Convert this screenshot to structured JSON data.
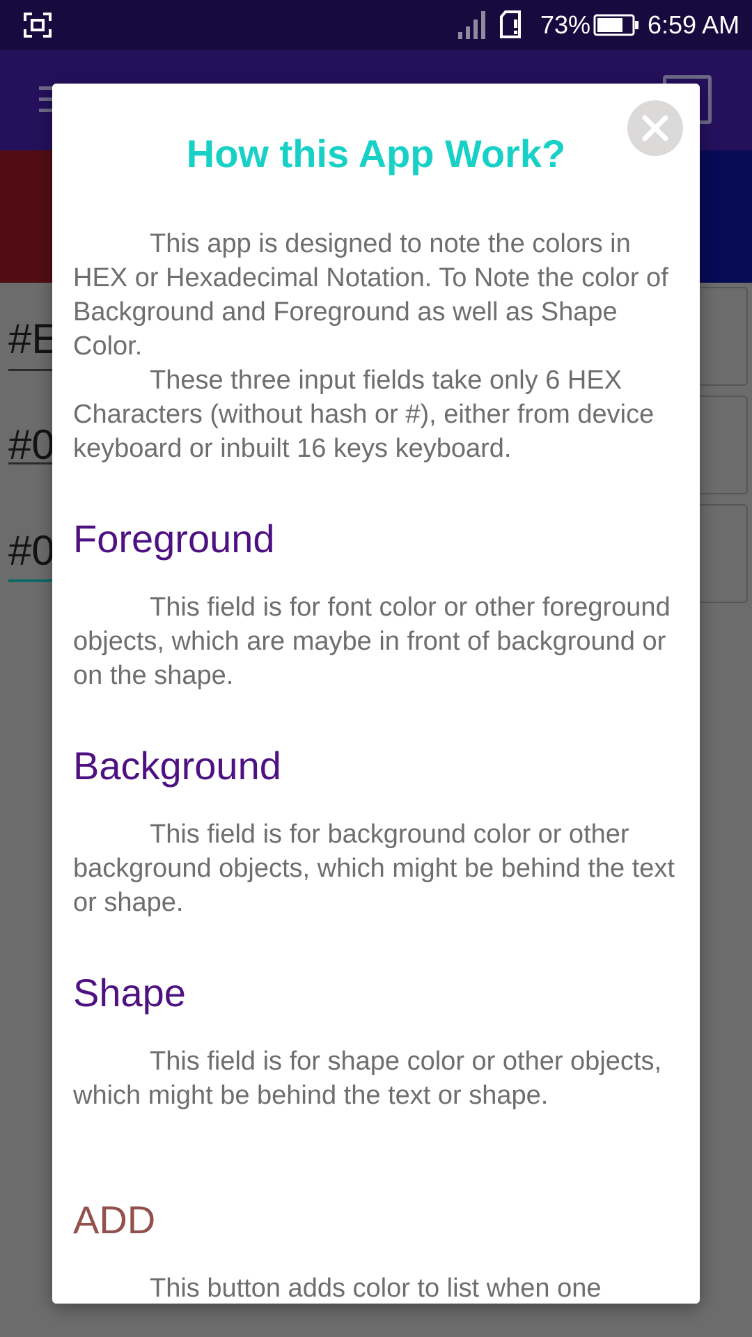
{
  "status_bar": {
    "battery_percent": "73%",
    "time": "6:59 AM",
    "icons": [
      "screenshot-icon",
      "signal-icon",
      "sim-icon",
      "battery-icon"
    ]
  },
  "background_app": {
    "hex_fields": [
      "#E",
      "#0",
      "#0"
    ],
    "colors": {
      "preview_left": "#520d14",
      "preview_right": "#070a55",
      "accent": "#0e6b66"
    }
  },
  "dialog": {
    "title": "How this App Work?",
    "close_icon": "close-icon",
    "intro_1": "This app is designed to note the colors in HEX or Hexadecimal Notation. To Note the color of Background and Foreground as well as Shape Color.",
    "intro_2": "These three input fields take only 6 HEX Characters (without hash or #), either from device keyboard or inbuilt 16 keys keyboard.",
    "sections": [
      {
        "heading": "Foreground",
        "text": "This field is for font color or other foreground objects, which are maybe in front of background or on the shape."
      },
      {
        "heading": "Background",
        "text": "This field is for background color or other background objects, which might be behind the text or shape."
      },
      {
        "heading": "Shape",
        "text": "This field is for shape color or other objects, which might be behind the text or shape."
      },
      {
        "heading": "ADD",
        "text": "This button adds color to list when one"
      }
    ],
    "colors": {
      "title": "#17d1c6",
      "heading": "#4e1182",
      "add_heading": "#93514d",
      "body_text": "#6e6e6e"
    }
  }
}
